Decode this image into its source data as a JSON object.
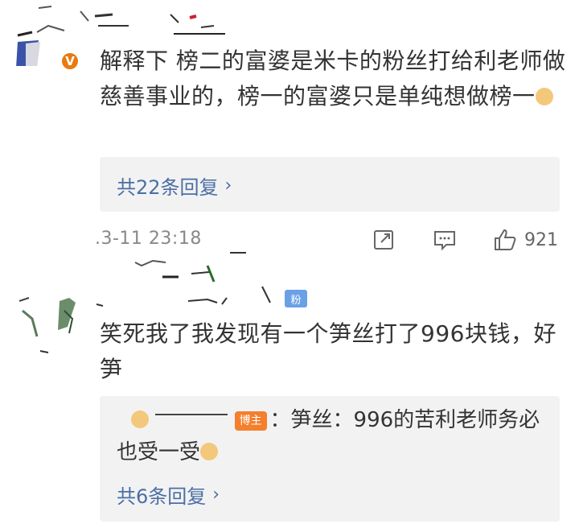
{
  "comments": [
    {
      "body": "解释下 榜二的富婆是米卡的粉丝打给利老师做慈善事业的，榜一的富婆只是单纯想做榜一",
      "reply_count_label": "共22条回复",
      "timestamp": ".3-11 23:18",
      "like_count": "921",
      "badge": "V"
    },
    {
      "body": "笑死我了我发现有一个笋丝打了996块钱，好笋",
      "fan_tag": "粉",
      "host_tag": "博主",
      "reply_text": "：笋丝：996的苦利老师务必也受一受",
      "reply_count_label": "共6条回复"
    }
  ],
  "icons": {
    "share": "share-icon",
    "comment": "comment-icon",
    "like": "thumb-up-icon",
    "chevron": "chevron-right-icon"
  },
  "colors": {
    "link": "#4a6fa5",
    "reply_bg": "#f2f2f2",
    "host_tag": "#f47f2c",
    "fan_tag": "#6aa1e6"
  }
}
